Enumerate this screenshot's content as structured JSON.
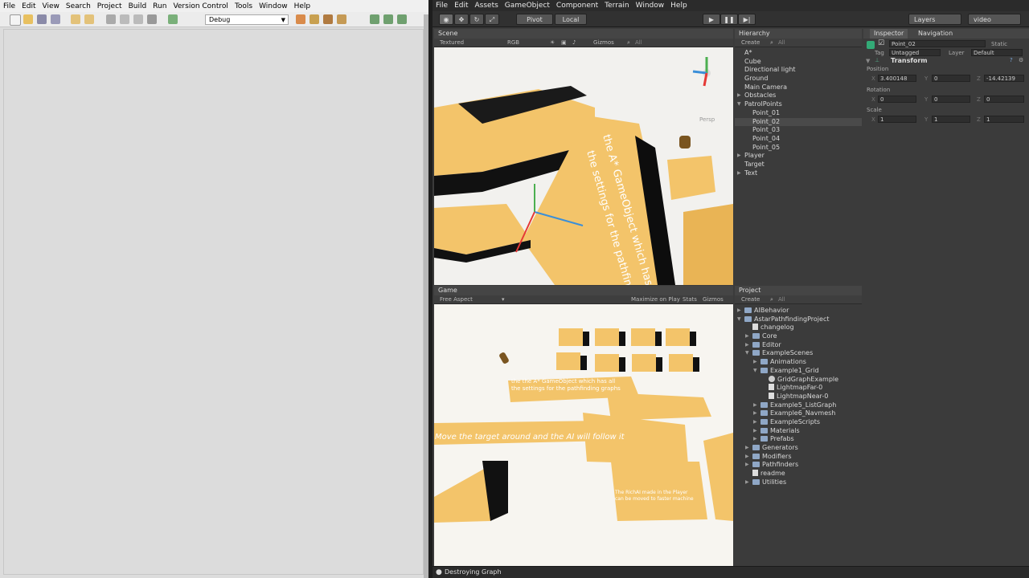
{
  "ide": {
    "menu": [
      "File",
      "Edit",
      "View",
      "Search",
      "Project",
      "Build",
      "Run",
      "Version Control",
      "Tools",
      "Window",
      "Help"
    ],
    "config": "Debug"
  },
  "unity": {
    "menu": [
      "File",
      "Edit",
      "Assets",
      "GameObject",
      "Component",
      "Terrain",
      "Window",
      "Help"
    ],
    "toolbar": {
      "pivot": "Pivot",
      "local": "Local",
      "layers": "Layers",
      "layout": "video"
    },
    "scene": {
      "tab": "Scene",
      "shading": "Textured",
      "rgb": "RGB",
      "gizmos": "Gizmos",
      "search": "All",
      "persp": "Persp",
      "text_line1": "the A* GameObject which has all",
      "text_line2": "the settings for the pathfinding graphs"
    },
    "hierarchy": {
      "tab": "Hierarchy",
      "create": "Create",
      "search": "All",
      "items": [
        {
          "label": "A*",
          "depth": 0,
          "fold": "none"
        },
        {
          "label": "Cube",
          "depth": 0,
          "fold": "none"
        },
        {
          "label": "Directional light",
          "depth": 0,
          "fold": "none"
        },
        {
          "label": "Ground",
          "depth": 0,
          "fold": "none"
        },
        {
          "label": "Main Camera",
          "depth": 0,
          "fold": "none"
        },
        {
          "label": "Obstacles",
          "depth": 0,
          "fold": "closed"
        },
        {
          "label": "PatrolPoints",
          "depth": 0,
          "fold": "open"
        },
        {
          "label": "Point_01",
          "depth": 1,
          "fold": "none"
        },
        {
          "label": "Point_02",
          "depth": 1,
          "fold": "none",
          "selected": true
        },
        {
          "label": "Point_03",
          "depth": 1,
          "fold": "none"
        },
        {
          "label": "Point_04",
          "depth": 1,
          "fold": "none"
        },
        {
          "label": "Point_05",
          "depth": 1,
          "fold": "none"
        },
        {
          "label": "Player",
          "depth": 0,
          "fold": "closed"
        },
        {
          "label": "Target",
          "depth": 0,
          "fold": "none"
        },
        {
          "label": "Text",
          "depth": 0,
          "fold": "closed"
        }
      ]
    },
    "inspector": {
      "tab": "Inspector",
      "tab2": "Navigation",
      "object_name": "Point_02",
      "static": "Static",
      "tag_label": "Tag",
      "tag": "Untagged",
      "layer_label": "Layer",
      "layer": "Default",
      "component": "Transform",
      "position_label": "Position",
      "rotation_label": "Rotation",
      "scale_label": "Scale",
      "position": {
        "x": "3.400148",
        "y": "0",
        "z": "-14.42139"
      },
      "rotation": {
        "x": "0",
        "y": "0",
        "z": "0"
      },
      "scale": {
        "x": "1",
        "y": "1",
        "z": "1"
      }
    },
    "game": {
      "tab": "Game",
      "aspect": "Free Aspect",
      "maximize": "Maximize on Play",
      "stats": "Stats",
      "gizmos": "Gizmos",
      "sign1_line1": "the the A* GameObject which has all",
      "sign1_line2": "the settings for the pathfinding graphs",
      "instruction": "Move the target around and the AI will follow it",
      "sign2_line1": "The RichAI made in the Player",
      "sign2_line2": "can be moved to faster machine"
    },
    "project": {
      "tab": "Project",
      "create": "Create",
      "search": "All",
      "items": [
        {
          "label": "AIBehavior",
          "depth": 0,
          "fold": "closed",
          "icon": "folder"
        },
        {
          "label": "AstarPathfindingProject",
          "depth": 0,
          "fold": "open",
          "icon": "folder"
        },
        {
          "label": "changelog",
          "depth": 1,
          "fold": "none",
          "icon": "doc"
        },
        {
          "label": "Core",
          "depth": 1,
          "fold": "closed",
          "icon": "folder"
        },
        {
          "label": "Editor",
          "depth": 1,
          "fold": "closed",
          "icon": "folder"
        },
        {
          "label": "ExampleScenes",
          "depth": 1,
          "fold": "open",
          "icon": "folder"
        },
        {
          "label": "Animations",
          "depth": 2,
          "fold": "closed",
          "icon": "folder"
        },
        {
          "label": "Example1_Grid",
          "depth": 2,
          "fold": "open",
          "icon": "folder"
        },
        {
          "label": "GridGraphExample",
          "depth": 3,
          "fold": "none",
          "icon": "scene"
        },
        {
          "label": "LightmapFar-0",
          "depth": 3,
          "fold": "none",
          "icon": "doc"
        },
        {
          "label": "LightmapNear-0",
          "depth": 3,
          "fold": "none",
          "icon": "doc"
        },
        {
          "label": "Example5_ListGraph",
          "depth": 2,
          "fold": "closed",
          "icon": "folder"
        },
        {
          "label": "Example6_Navmesh",
          "depth": 2,
          "fold": "closed",
          "icon": "folder"
        },
        {
          "label": "ExampleScripts",
          "depth": 2,
          "fold": "closed",
          "icon": "folder"
        },
        {
          "label": "Materials",
          "depth": 2,
          "fold": "closed",
          "icon": "folder"
        },
        {
          "label": "Prefabs",
          "depth": 2,
          "fold": "closed",
          "icon": "folder"
        },
        {
          "label": "Generators",
          "depth": 1,
          "fold": "closed",
          "icon": "folder"
        },
        {
          "label": "Modifiers",
          "depth": 1,
          "fold": "closed",
          "icon": "folder"
        },
        {
          "label": "Pathfinders",
          "depth": 1,
          "fold": "closed",
          "icon": "folder"
        },
        {
          "label": "readme",
          "depth": 1,
          "fold": "none",
          "icon": "doc"
        },
        {
          "label": "Utilities",
          "depth": 1,
          "fold": "closed",
          "icon": "folder"
        }
      ]
    },
    "status": "Destroying Graph",
    "colors": {
      "tile": "#f3c46a",
      "tile_side": "#d49a3a",
      "floor": "#f2f1ee",
      "selection": "#4a4a4a"
    }
  }
}
